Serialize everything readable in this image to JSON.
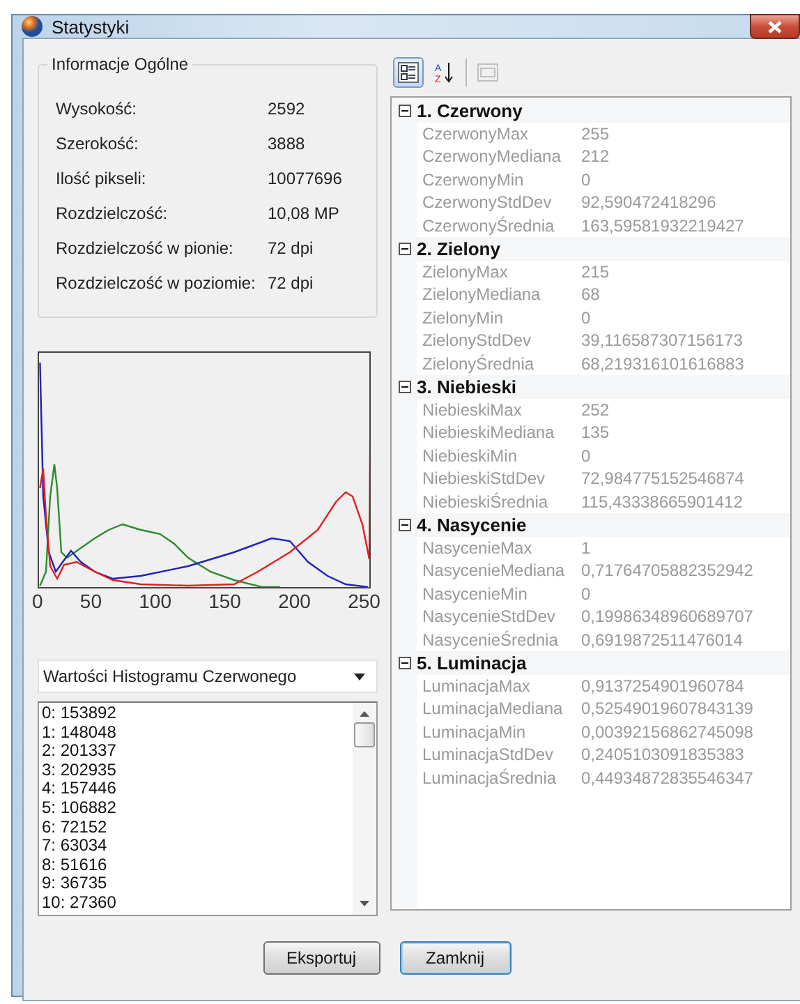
{
  "window": {
    "title": "Statystyki"
  },
  "general_info": {
    "title": "Informacje Ogólne",
    "rows": [
      {
        "label": "Wysokość:",
        "value": "2592"
      },
      {
        "label": "Szerokość:",
        "value": "3888"
      },
      {
        "label": "Ilość pikseli:",
        "value": "10077696"
      },
      {
        "label": "Rozdzielczość:",
        "value": "10,08 MP"
      },
      {
        "label": "Rozdzielczość w pionie:",
        "value": "72 dpi"
      },
      {
        "label": "Rozdzielczość w poziomie:",
        "value": "72 dpi"
      }
    ]
  },
  "histogram": {
    "tick_labels": [
      "0",
      "50",
      "100",
      "150",
      "200",
      "250"
    ]
  },
  "histogram_select": {
    "value": "Wartości Histogramu Czerwonego"
  },
  "histogram_values": [
    "0: 153892",
    "1: 148048",
    "2: 201337",
    "3: 202935",
    "4: 157446",
    "5: 106882",
    "6: 72152",
    "7: 63034",
    "8: 51616",
    "9: 36735",
    "10: 27360"
  ],
  "toolbar": [
    {
      "kind": "categorized",
      "selected": true,
      "disabled": false
    },
    {
      "kind": "alphabetical",
      "letters": [
        "A",
        "Z"
      ],
      "selected": false,
      "disabled": false
    },
    {
      "kind": "pages",
      "selected": false,
      "disabled": true
    }
  ],
  "properties": [
    {
      "title": "1. Czerwony",
      "expanded": true,
      "rows": [
        {
          "name": "CzerwonyMax",
          "value": "255"
        },
        {
          "name": "CzerwonyMediana",
          "value": "212"
        },
        {
          "name": "CzerwonyMin",
          "value": "0"
        },
        {
          "name": "CzerwonyStdDev",
          "value": "92,590472418296"
        },
        {
          "name": "CzerwonyŚrednia",
          "value": "163,59581932219427"
        }
      ]
    },
    {
      "title": "2. Zielony",
      "expanded": true,
      "rows": [
        {
          "name": "ZielonyMax",
          "value": "215"
        },
        {
          "name": "ZielonyMediana",
          "value": "68"
        },
        {
          "name": "ZielonyMin",
          "value": "0"
        },
        {
          "name": "ZielonyStdDev",
          "value": "39,116587307156173"
        },
        {
          "name": "ZielonyŚrednia",
          "value": "68,219316101616883"
        }
      ]
    },
    {
      "title": "3. Niebieski",
      "expanded": true,
      "rows": [
        {
          "name": "NiebieskiMax",
          "value": "252"
        },
        {
          "name": "NiebieskiMediana",
          "value": "135"
        },
        {
          "name": "NiebieskiMin",
          "value": "0"
        },
        {
          "name": "NiebieskiStdDev",
          "value": "72,984775152546874"
        },
        {
          "name": "NiebieskiŚrednia",
          "value": "115,43338665901412"
        }
      ]
    },
    {
      "title": "4. Nasycenie",
      "expanded": true,
      "rows": [
        {
          "name": "NasycenieMax",
          "value": "1"
        },
        {
          "name": "NasycenieMediana",
          "value": "0,71764705882352942"
        },
        {
          "name": "NasycenieMin",
          "value": "0"
        },
        {
          "name": "NasycenieStdDev",
          "value": "0,19986348960689707"
        },
        {
          "name": "NasycenieŚrednia",
          "value": "0,6919872511476014"
        }
      ]
    },
    {
      "title": "5. Luminacja",
      "expanded": true,
      "rows": [
        {
          "name": "LuminacjaMax",
          "value": "0,9137254901960784"
        },
        {
          "name": "LuminacjaMediana",
          "value": "0,52549019607843139"
        },
        {
          "name": "LuminacjaMin",
          "value": "0,00392156862745098"
        },
        {
          "name": "LuminacjaStdDev",
          "value": "0,2405103091835383"
        },
        {
          "name": "LuminacjaŚrednia",
          "value": "0,44934872835546347"
        }
      ]
    }
  ],
  "buttons": [
    {
      "label": "Eksportuj",
      "focused": false
    },
    {
      "label": "Zamknij",
      "focused": true
    }
  ]
}
